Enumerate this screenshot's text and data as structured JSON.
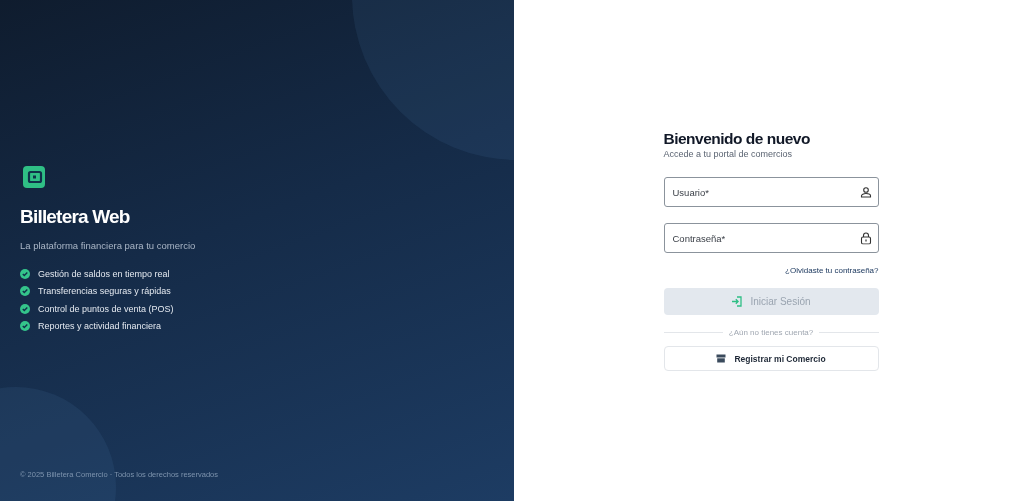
{
  "brand": {
    "name": "Billetera Web",
    "tagline": "La plataforma financiera para tu comercio"
  },
  "features": [
    "Gestión de saldos en tiempo real",
    "Transferencias seguras y rápidas",
    "Control de puntos de venta (POS)",
    "Reportes y actividad financiera"
  ],
  "footer": "© 2025 Billetera Comercio · Todos los derechos reservados",
  "login": {
    "title": "Bienvenido de nuevo",
    "subtitle": "Accede a tu portal de comercios",
    "fields": [
      {
        "kind": "user",
        "placeholder": "Usuario*"
      },
      {
        "kind": "password",
        "placeholder": "Contraseña*"
      }
    ],
    "forgot_link": "¿Olvidaste tu contraseña?",
    "submit": {
      "label": "Iniciar Sesión",
      "disabled": true
    },
    "divider": "¿Aún no tienes cuenta?",
    "register": "Registrar mi Comercio"
  }
}
